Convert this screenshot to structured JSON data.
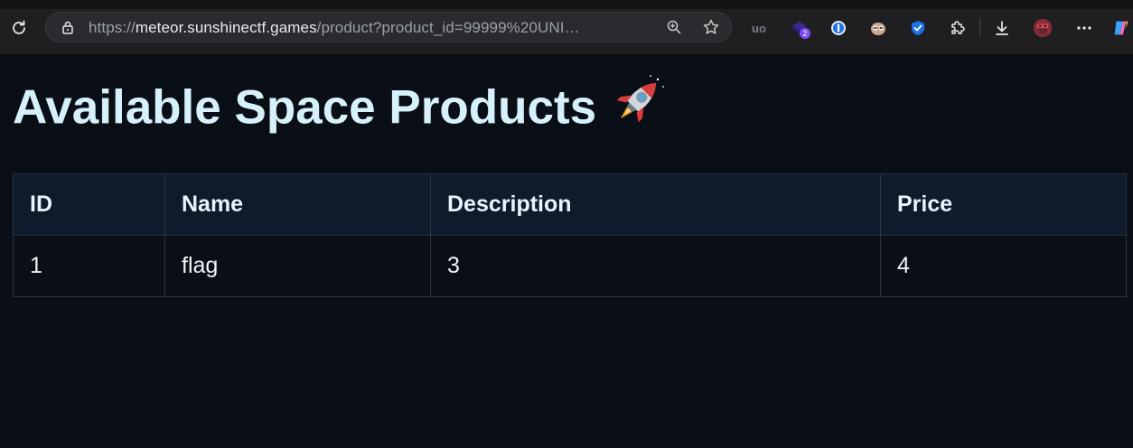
{
  "browser": {
    "url_scheme": "https://",
    "url_host": "meteor.sunshinectf.games",
    "url_path": "/product?product_id=99999%20UNI…",
    "extensions": [
      {
        "name": "ublock-icon",
        "label": "uo"
      },
      {
        "name": "extension-badge-icon",
        "label": "2"
      },
      {
        "name": "onepassword-icon",
        "label": ""
      },
      {
        "name": "owl-icon",
        "label": ""
      },
      {
        "name": "checkmark-shield-icon",
        "label": ""
      },
      {
        "name": "puzzle-icon",
        "label": ""
      }
    ],
    "colors": {
      "frame": "#1f1f22",
      "omnibox": "#2b2b2f",
      "badge": "#7c4dff"
    }
  },
  "page": {
    "heading": "Available Space Products",
    "heading_icon": "rocket-icon",
    "table": {
      "headers": [
        "ID",
        "Name",
        "Description",
        "Price"
      ],
      "rows": [
        [
          "1",
          "flag",
          "3",
          "4"
        ]
      ]
    },
    "colors": {
      "background": "#0a0e16",
      "heading": "#d7f1fb",
      "header_bg": "#0f1b2b",
      "border": "#2b3443"
    }
  }
}
